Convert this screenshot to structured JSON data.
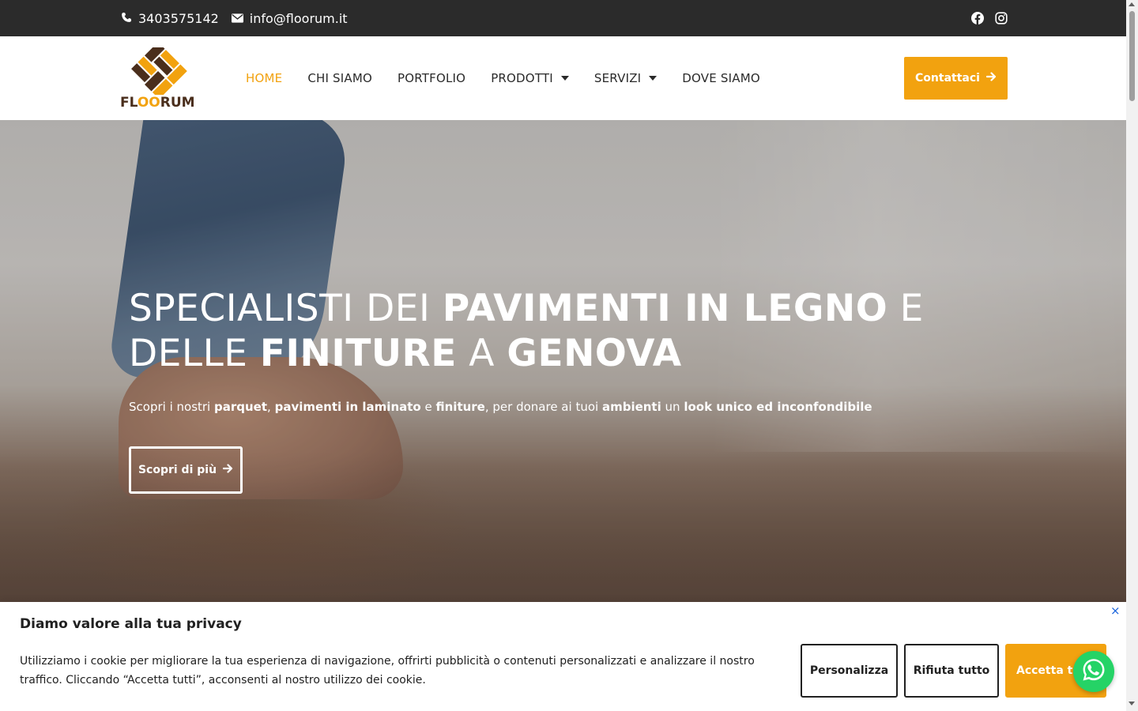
{
  "topbar": {
    "phone": "3403575142",
    "email": "info@floorum.it",
    "social_icons": [
      "facebook-icon",
      "instagram-icon"
    ]
  },
  "header": {
    "logo_text": {
      "part1": "FL",
      "part2": "O",
      "part3": "O",
      "part4": "RUM"
    },
    "nav": [
      {
        "label": "HOME",
        "active": true
      },
      {
        "label": "CHI SIAMO"
      },
      {
        "label": "PORTFOLIO"
      },
      {
        "label": "PRODOTTI",
        "dropdown": true
      },
      {
        "label": "SERVIZI",
        "dropdown": true
      },
      {
        "label": "DOVE SIAMO"
      }
    ],
    "cta_label": "Contattaci"
  },
  "hero": {
    "title": {
      "t1": "SPECIALISTI DEI ",
      "t2": "PAVIMENTI IN LEGNO",
      "t3": " E DELLE ",
      "t4": "FINITURE",
      "t5": " A ",
      "t6": "GENOVA"
    },
    "subtitle": {
      "s1": "Scopri i nostri ",
      "s2": "parquet",
      "s3": ", ",
      "s4": "pavimenti in laminato",
      "s5": " e ",
      "s6": "finiture",
      "s7": ", per donare ai tuoi ",
      "s8": "ambienti",
      "s9": " un ",
      "s10": "look unico ed inconfondibile"
    },
    "button_label": "Scopri di più"
  },
  "cookie": {
    "title": "Diamo valore alla tua privacy",
    "text": "Utilizziamo i cookie per migliorare la tua esperienza di navigazione, offrirti pubblicità o contenuti personalizzati e analizzare il nostro traffico. Cliccando “Accetta tutti”, acconsenti al nostro utilizzo dei cookie.",
    "customize_label": "Personalizza",
    "reject_label": "Rifiuta tutto",
    "accept_label": "Accetta tutti",
    "close_symbol": "×"
  },
  "colors": {
    "accent": "#f2a20f",
    "topbar_bg": "#2b2b2b",
    "logo_brown": "#4a2e1c",
    "whatsapp": "#25d366"
  }
}
